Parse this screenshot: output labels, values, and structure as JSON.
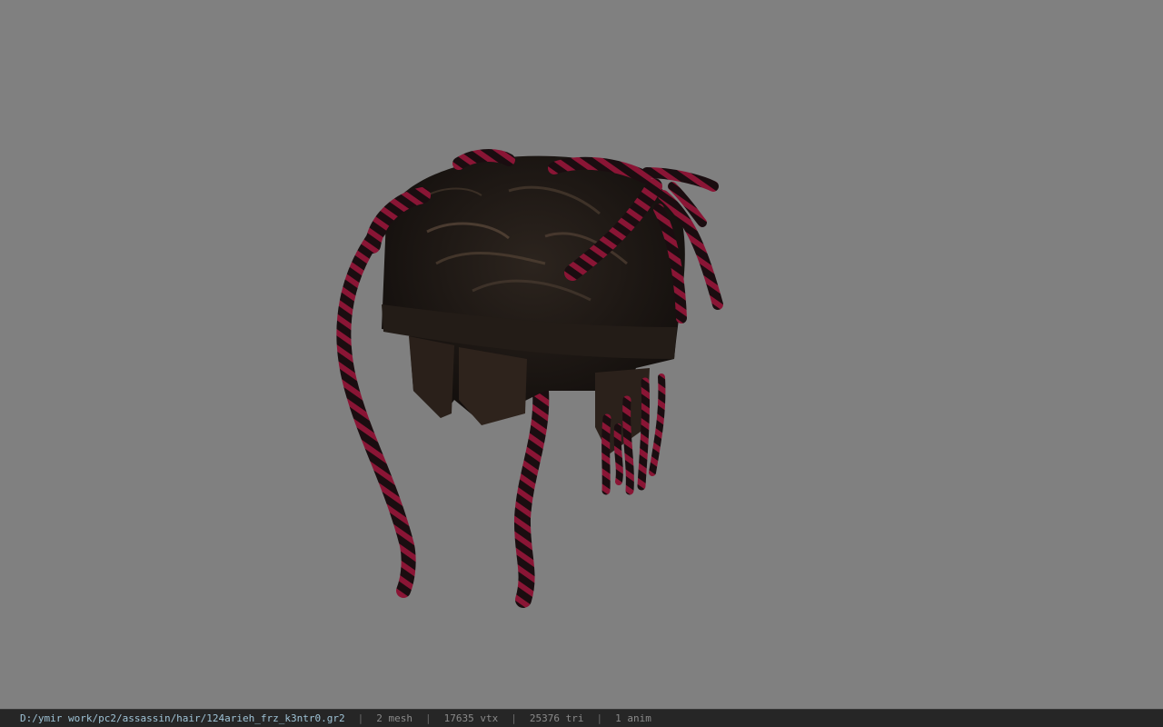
{
  "viewer": {
    "background_color": "#808080",
    "model": {
      "subject": "braided hair mesh",
      "base_color": "#1c1714",
      "braid_color_a": "#8a1535",
      "braid_color_b": "#1a0d10"
    }
  },
  "status_bar": {
    "file_path": "D:/ymir work/pc2/assassin/hair/124arieh_frz_k3ntr0.gr2",
    "separator": "|",
    "mesh_count": "2 mesh",
    "vertex_count": "17635 vtx",
    "triangle_count": "25376 tri",
    "anim_count": "1 anim"
  }
}
